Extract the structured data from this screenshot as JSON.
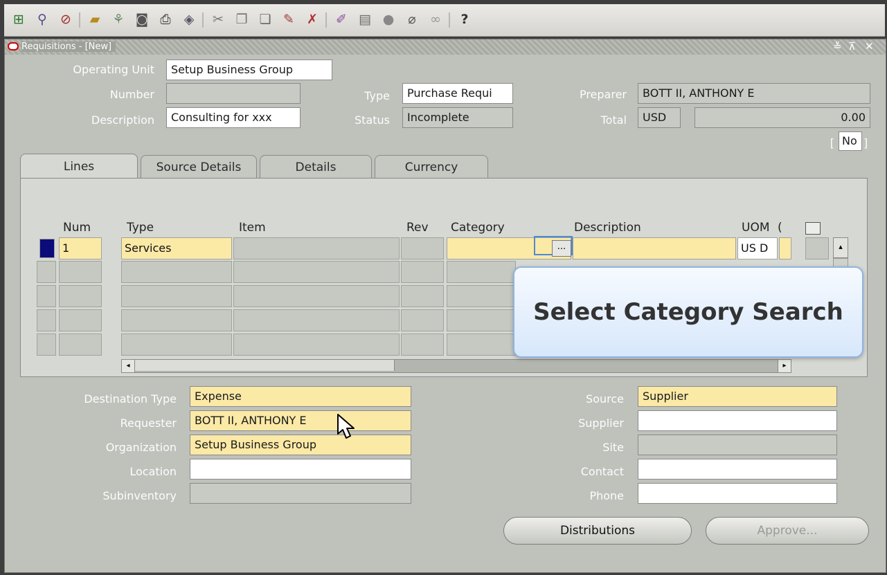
{
  "toolbar": {
    "icons": [
      "new-icon",
      "find-icon",
      "navigator-icon",
      "open-folder-icon",
      "zoom-icon",
      "translate-icon",
      "print-icon",
      "save-icon",
      "cut-icon",
      "copy-icon",
      "paste-icon",
      "edit-icon",
      "clear-icon",
      "attach-icon",
      "folder-icon",
      "globe-icon",
      "paperclip-icon",
      "help-glasses-icon"
    ],
    "help_glyph": "?"
  },
  "window": {
    "title": "Requisitions - [New]",
    "controls": [
      "≚",
      "⊼",
      "✕"
    ]
  },
  "header": {
    "operating_unit_label": "Operating Unit",
    "operating_unit": "Setup Business Group",
    "number_label": "Number",
    "number": "",
    "type_label": "Type",
    "type": "Purchase Requi",
    "preparer_label": "Preparer",
    "preparer": "BOTT II, ANTHONY E",
    "description_label": "Description",
    "description": "Consulting for xxx",
    "status_label": "Status",
    "status": "Incomplete",
    "total_label": "Total",
    "currency": "USD",
    "total": "0.00",
    "flag_open": "[",
    "flag_value": "No",
    "flag_close": "]"
  },
  "tabs": [
    "Lines",
    "Source Details",
    "Details",
    "Currency"
  ],
  "lines": {
    "columns": [
      "Num",
      "Type",
      "Item",
      "Rev",
      "Category",
      "Description",
      "UOM",
      "("
    ],
    "rows": [
      {
        "num": "1",
        "type": "Services",
        "item": "",
        "rev": "",
        "category": "",
        "description": "",
        "uom": "US D"
      },
      {
        "num": "",
        "type": "",
        "item": "",
        "rev": "",
        "category": "",
        "description": "",
        "uom": ""
      },
      {
        "num": "",
        "type": "",
        "item": "",
        "rev": "",
        "category": "",
        "description": "",
        "uom": ""
      },
      {
        "num": "",
        "type": "",
        "item": "",
        "rev": "",
        "category": "",
        "description": "",
        "uom": ""
      },
      {
        "num": "",
        "type": "",
        "item": "",
        "rev": "",
        "category": "",
        "description": "",
        "uom": ""
      }
    ],
    "lov_button": "...",
    "callout": "Select Category Search"
  },
  "footer": {
    "destination_type_label": "Destination Type",
    "destination_type": "Expense",
    "requester_label": "Requester",
    "requester": "BOTT II, ANTHONY E",
    "organization_label": "Organization",
    "organization": "Setup Business Group",
    "location_label": "Location",
    "location": "",
    "subinventory_label": "Subinventory",
    "subinventory": "",
    "source_label": "Source",
    "source": "Supplier",
    "supplier_label": "Supplier",
    "supplier": "",
    "site_label": "Site",
    "site": "",
    "contact_label": "Contact",
    "contact": "",
    "phone_label": "Phone",
    "phone": ""
  },
  "buttons": {
    "distributions": "Distributions",
    "approve": "Approve..."
  }
}
